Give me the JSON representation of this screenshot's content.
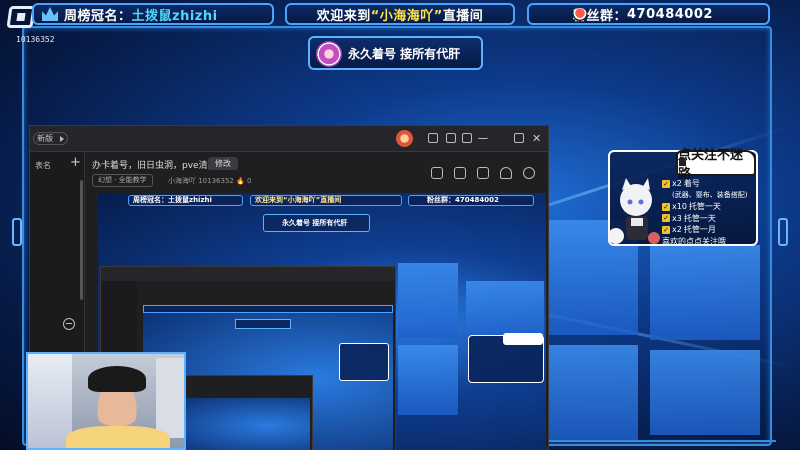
{
  "overlay": {
    "room_id": "10136352",
    "top_left": {
      "prefix": "周榜冠名：",
      "name": "土拨鼠zhizhi"
    },
    "top_center": {
      "pre": "欢迎来到",
      "name": "“小海海吖”",
      "post": "直播间"
    },
    "top_right": {
      "label": "粉丝群：",
      "number": "470484002"
    },
    "badge_text": "永久着号  接所有代肝"
  },
  "app": {
    "tab_label": "新版",
    "sidebar_label": "表名",
    "stream_title": "办卡着号，旧日虫洞，pve清缚",
    "edit_button": "修改",
    "category": "幻想 · 全能教学",
    "meta": "小海海吖  10136352  🔥 0"
  },
  "preview": {
    "bar_left": "周榜冠名：土拨鼠zhizhi",
    "bar_mid": "欢迎来到“小海海吖”直播间",
    "bar_right": "粉丝群：470484002",
    "badge": "永久着号  接所有代肝",
    "room_id": "10136352"
  },
  "follow_card": {
    "title": "点关注不迷路",
    "items": [
      {
        "qty": "x2",
        "text": "着号"
      },
      {
        "qty": "",
        "text": "(武器、婴布、装备搭配)"
      },
      {
        "qty": "x10",
        "text": "托管一天"
      },
      {
        "qty": "x3",
        "text": "托管一天"
      },
      {
        "qty": "x2",
        "text": "托管一月"
      },
      {
        "qty": "",
        "text": "喜欢的点点关注哦"
      }
    ]
  },
  "colors": {
    "frame_blue": "#3a8bd8",
    "accent_cyan": "#4fd8ff",
    "accent_yellow": "#ffe24a",
    "checkbox": "#f2c12e"
  }
}
